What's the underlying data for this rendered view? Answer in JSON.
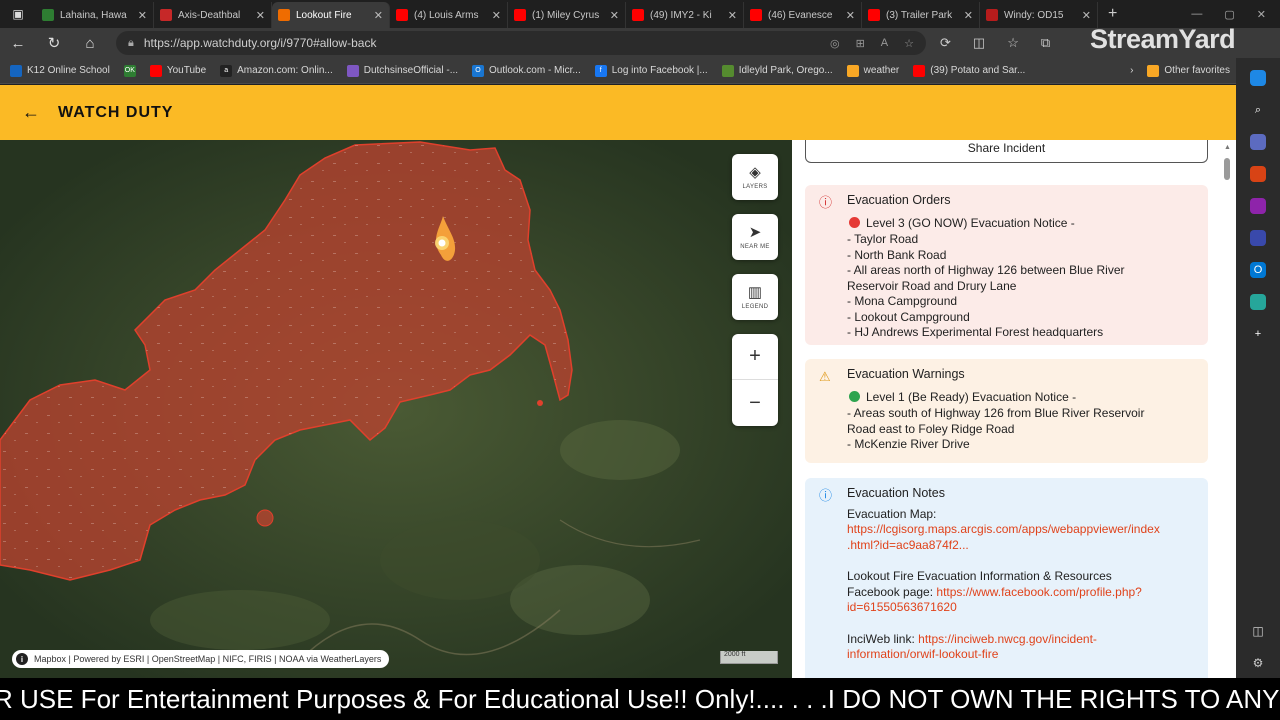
{
  "browser": {
    "tabs": [
      {
        "title": "Lahaina, Hawa",
        "color": "#2e7d32",
        "glyph": "",
        "active": false
      },
      {
        "title": "Axis-Deathbal",
        "color": "#c62828",
        "glyph": "",
        "active": false
      },
      {
        "title": "Lookout Fire",
        "color": "#ef6c00",
        "glyph": "",
        "active": true
      },
      {
        "title": "(4) Louis Arms",
        "color": "#ff0000",
        "glyph": "",
        "active": false
      },
      {
        "title": "(1) Miley Cyrus",
        "color": "#ff0000",
        "glyph": "",
        "active": false
      },
      {
        "title": "(49) IMY2 - Ki",
        "color": "#ff0000",
        "glyph": "",
        "active": false
      },
      {
        "title": "(46) Evanesce",
        "color": "#ff0000",
        "glyph": "",
        "active": false
      },
      {
        "title": "(3) Trailer Park",
        "color": "#ff0000",
        "glyph": "",
        "active": false
      },
      {
        "title": "Windy: OD15",
        "color": "#b71c1c",
        "glyph": "",
        "active": false
      }
    ],
    "url": "https://app.watchduty.org/i/9770#allow-back",
    "bookmarks": [
      {
        "label": "K12 Online School",
        "color": "#1565c0",
        "glyph": ""
      },
      {
        "label": "OK",
        "color": "#2e7d32",
        "glyph": "OK",
        "textless": true
      },
      {
        "label": "YouTube",
        "color": "#ff0000",
        "glyph": ""
      },
      {
        "label": "Amazon.com: Onlin...",
        "color": "#222222",
        "glyph": "a"
      },
      {
        "label": "DutchsinseOfficial -...",
        "color": "#7e57c2",
        "glyph": ""
      },
      {
        "label": "Outlook.com - Micr...",
        "color": "#1976d2",
        "glyph": "O"
      },
      {
        "label": "Log into Facebook |...",
        "color": "#1877f2",
        "glyph": "f"
      },
      {
        "label": "Idleyld Park, Orego...",
        "color": "#558b2f",
        "glyph": ""
      },
      {
        "label": "weather",
        "color": "#f9a825",
        "glyph": ""
      },
      {
        "label": "(39) Potato and Sar...",
        "color": "#ff0000",
        "glyph": ""
      }
    ],
    "other_favorites": "Other favorites",
    "overlay_brand": "StreamYard"
  },
  "app": {
    "brand": "WATCH DUTY",
    "map_controls": {
      "layers": "LAYERS",
      "near_me": "NEAR ME",
      "legend": "LEGEND"
    },
    "attribution": "Mapbox | Powered by ESRI | OpenStreetMap | NIFC, FIRIS | NOAA via WeatherLayers",
    "scale": "2000 ft",
    "share_label": "Share Incident",
    "evac_orders": {
      "heading": "Evacuation Orders",
      "level": "Level 3 (GO NOW) Evacuation Notice -",
      "lines": [
        "- Taylor Road",
        "- North Bank Road",
        "- All areas north of Highway 126 between Blue River",
        "Reservoir Road and Drury Lane",
        "- Mona Campground",
        "- Lookout Campground",
        "- HJ Andrews Experimental Forest headquarters"
      ]
    },
    "evac_warnings": {
      "heading": "Evacuation Warnings",
      "level": "Level 1 (Be Ready) Evacuation Notice -",
      "lines": [
        "- Areas south of Highway 126 from Blue River Reservoir",
        "Road east to Foley Ridge Road",
        "- McKenzie River Drive"
      ]
    },
    "evac_notes": {
      "heading": "Evacuation Notes",
      "map_label": "Evacuation Map:",
      "map_link_1": "https://lcgisorg.maps.arcgis.com/apps/webappviewer/index",
      "map_link_2": ".html?id=ac9aa874f2...",
      "info_label_1": "Lookout Fire Evacuation Information & Resources",
      "info_label_2": "Facebook page: ",
      "fb_link_1": "https://www.facebook.com/profile.php?",
      "fb_link_2": "id=61550563671620",
      "inciweb_label": "InciWeb link: ",
      "inciweb_link_1": "https://inciweb.nwcg.gov/incident-",
      "inciweb_link_2": "information/orwif-lookout-fire"
    }
  },
  "ticker": "R USE For Entertainment Purposes & For Educational Use!! Only!.... . . .I DO NOT OWN THE RIGHTS TO ANY",
  "colors": {
    "appbar": "#fbba25",
    "fire_fill": "#b8432f",
    "order_dot": "#e53935",
    "warning_dot": "#2ea44f",
    "link": "#e0431b"
  }
}
